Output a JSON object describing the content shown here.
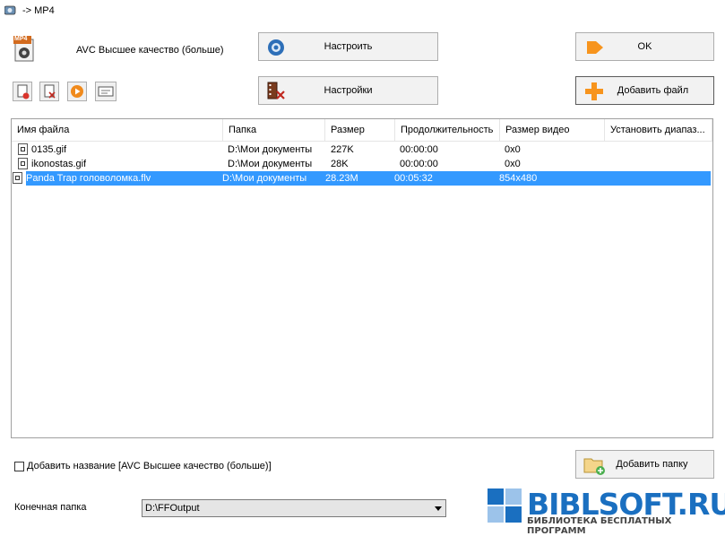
{
  "window": {
    "title": "-> MP4"
  },
  "profile": {
    "label": "AVC Высшее качество (больше)",
    "badge": "MP4"
  },
  "buttons": {
    "configure": "Настроить",
    "settings": "Настройки",
    "ok": "OK",
    "add_file": "Добавить файл",
    "add_folder": "Добавить папку"
  },
  "toolbar": {
    "icons": [
      "remove-file-icon",
      "clear-list-icon",
      "play-icon",
      "media-info-icon"
    ]
  },
  "table": {
    "columns": [
      "Имя файла",
      "Папка",
      "Размер",
      "Продолжительность",
      "Размер видео",
      "Установить диапаз..."
    ],
    "rows": [
      {
        "name": "0135.gif",
        "folder": "D:\\Мои документы",
        "size": "227K",
        "duration": "00:00:00",
        "video_size": "0x0",
        "range": "",
        "selected": false
      },
      {
        "name": "ikonostas.gif",
        "folder": "D:\\Мои документы",
        "size": "28K",
        "duration": "00:00:00",
        "video_size": "0x0",
        "range": "",
        "selected": false
      },
      {
        "name": "Panda Trap головоломка.flv",
        "folder": "D:\\Мои документы",
        "size": "28.23M",
        "duration": "00:05:32",
        "video_size": "854x480",
        "range": "",
        "selected": true
      }
    ]
  },
  "options": {
    "add_name_label": "Добавить название [AVC Высшее качество (больше)]",
    "add_name_checked": false
  },
  "output": {
    "label": "Конечная папка",
    "folder": "D:\\FFOutput"
  },
  "watermark": {
    "text": "BIBLSOFT.RU",
    "subtitle": "БИБЛИОТЕКА БЕСПЛАТНЫХ ПРОГРАММ"
  },
  "colors": {
    "selection": "#3399ff",
    "accent_orange": "#f7941d",
    "watermark_blue": "#1a6fc0"
  }
}
